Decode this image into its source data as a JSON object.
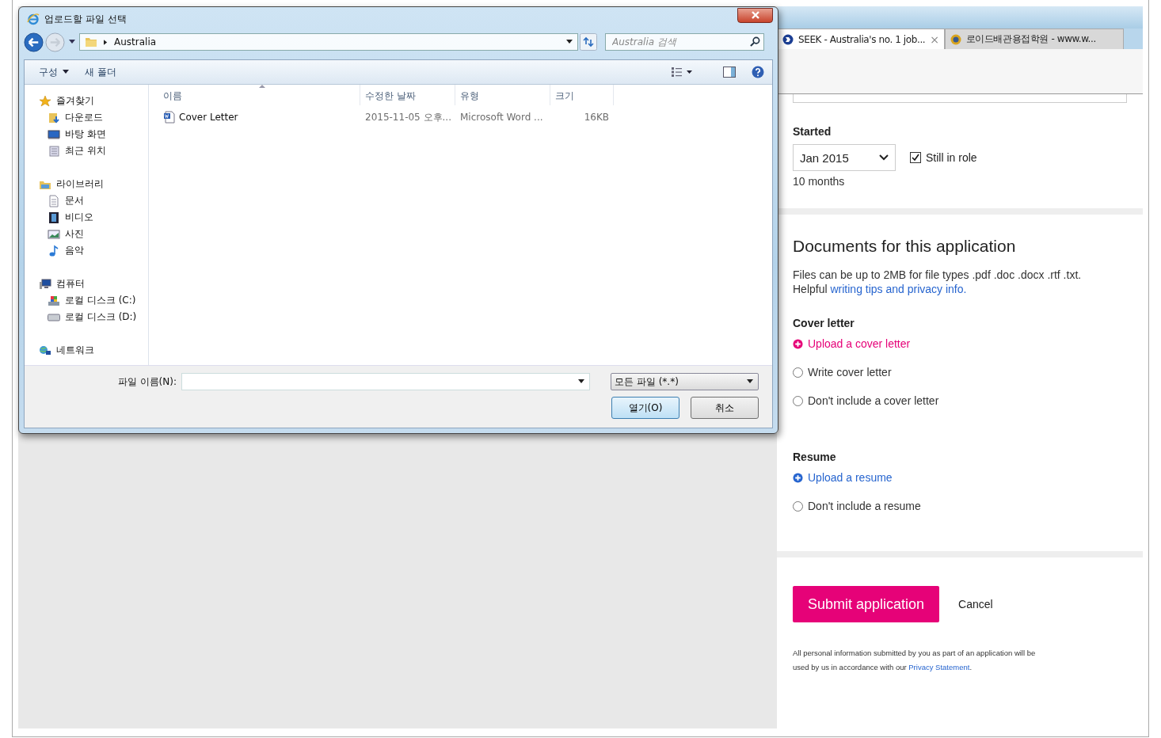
{
  "browser": {
    "tabs": [
      {
        "title": "SEEK - Australia's no. 1 job...",
        "selected": true,
        "close": "×"
      },
      {
        "title": "로이드배관용접학원 - www.w...",
        "selected": false
      }
    ]
  },
  "form": {
    "started": {
      "label": "Started",
      "value": "Jan 2015",
      "still_in_role": {
        "label": "Still in role",
        "checked": true
      },
      "duration": "10 months"
    },
    "documents": {
      "title": "Documents for this application",
      "info": "Files can be up to 2MB for file types .pdf .doc .docx .rtf .txt.",
      "helpful": "Helpful",
      "link": "writing tips and privacy info."
    },
    "sections": [
      {
        "title": "Cover letter",
        "options": [
          {
            "kind": "upload",
            "label": "Upload a cover letter",
            "color": "#e60278"
          },
          {
            "kind": "radio",
            "label": "Write cover letter",
            "selected": false
          },
          {
            "kind": "radio",
            "label": "Don't include a cover letter",
            "selected": false
          }
        ]
      },
      {
        "title": "Resume",
        "options": [
          {
            "kind": "upload",
            "label": "Upload a resume",
            "color": "#2765cf"
          },
          {
            "kind": "radio",
            "label": "Don't include a resume",
            "selected": false
          }
        ]
      }
    ],
    "actions": {
      "submit": "Submit application",
      "cancel": "Cancel"
    },
    "privacy": {
      "text": "All personal information submitted by you as part of an application will be used by us in accordance with our",
      "link": "Privacy Statement",
      "end": "."
    }
  },
  "dialog": {
    "title": "업로드할 파일 선택",
    "path": [
      "Australia"
    ],
    "search_placeholder": "Australia 검색",
    "commands": {
      "organize": "구성",
      "new_folder": "새 폴더"
    },
    "nav": [
      {
        "label": "즐겨찾기",
        "kind": "star",
        "children": [
          {
            "label": "다운로드",
            "kind": "download"
          },
          {
            "label": "바탕 화면",
            "kind": "desktop"
          },
          {
            "label": "최근 위치",
            "kind": "recent"
          }
        ]
      },
      {
        "label": "라이브러리",
        "kind": "library",
        "children": [
          {
            "label": "문서",
            "kind": "document"
          },
          {
            "label": "비디오",
            "kind": "video"
          },
          {
            "label": "사진",
            "kind": "picture"
          },
          {
            "label": "음악",
            "kind": "music"
          }
        ]
      },
      {
        "label": "컴퓨터",
        "kind": "computer",
        "children": [
          {
            "label": "로컬 디스크 (C:)",
            "kind": "system-drive"
          },
          {
            "label": "로컬 디스크 (D:)",
            "kind": "drive"
          }
        ]
      },
      {
        "label": "네트워크",
        "kind": "network"
      }
    ],
    "columns": [
      {
        "label": "이름",
        "sorted": true
      },
      {
        "label": "수정한 날짜",
        "sorted": false
      },
      {
        "label": "유형",
        "sorted": false
      },
      {
        "label": "크기",
        "sorted": false
      }
    ],
    "files": [
      {
        "name": "Cover Letter",
        "modified": "2015-11-05 오후...",
        "type": "Microsoft Word ...",
        "size": "16KB"
      }
    ],
    "filename_label": "파일 이름(N):",
    "filetype": "모든 파일 (*.*)",
    "buttons": [
      {
        "label": "열기(O)",
        "default": true
      },
      {
        "label": "취소",
        "default": false
      }
    ]
  }
}
